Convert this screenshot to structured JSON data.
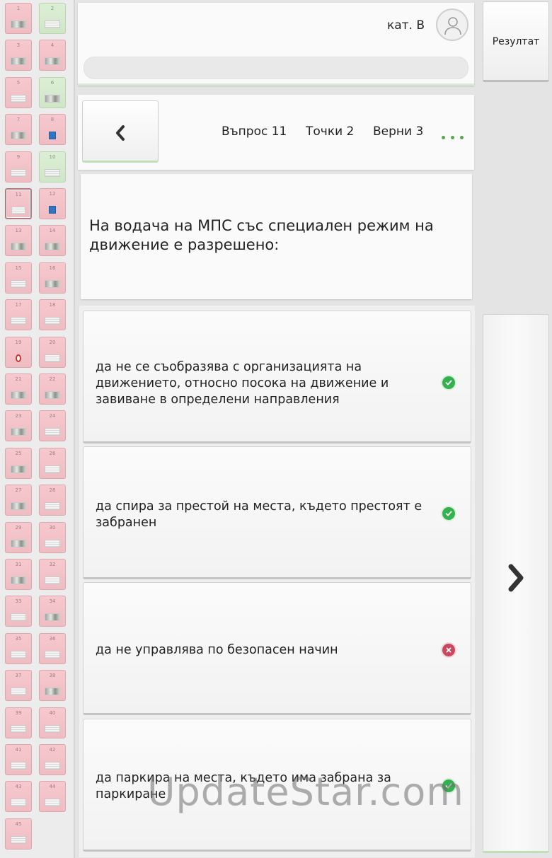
{
  "header": {
    "category": "кат. B",
    "result_label": "Резултат"
  },
  "nav": {
    "question": "Въпрос 11",
    "points": "Точки 2",
    "correct": "Верни 3"
  },
  "question": {
    "text": "На водача на МПС със специален режим на движение е разрешено:"
  },
  "answers": [
    {
      "text": "да не се съобразява с организацията на движението, относно посока на движение и завиване в определени направления",
      "mark": "correct"
    },
    {
      "text": "да спира за престой на места, където престоят е забранен",
      "mark": "correct"
    },
    {
      "text": "да не управлява по безопасен начин",
      "mark": "wrong"
    },
    {
      "text": "да паркира на места, където има забрана за паркиране",
      "mark": "correct"
    }
  ],
  "sidebar": {
    "questions": [
      {
        "n": "1",
        "state": "wrong",
        "pic": "photo"
      },
      {
        "n": "2",
        "state": "good",
        "pic": "lines"
      },
      {
        "n": "3",
        "state": "wrong",
        "pic": "photo"
      },
      {
        "n": "4",
        "state": "wrong",
        "pic": "photo"
      },
      {
        "n": "5",
        "state": "wrong",
        "pic": "lines"
      },
      {
        "n": "6",
        "state": "good",
        "pic": "photo"
      },
      {
        "n": "7",
        "state": "wrong",
        "pic": "photo"
      },
      {
        "n": "8",
        "state": "wrong",
        "pic": "sign-blue"
      },
      {
        "n": "9",
        "state": "wrong",
        "pic": "lines"
      },
      {
        "n": "10",
        "state": "good",
        "pic": "lines"
      },
      {
        "n": "11",
        "state": "current",
        "pic": "lines"
      },
      {
        "n": "12",
        "state": "wrong",
        "pic": "sign-blue"
      },
      {
        "n": "13",
        "state": "wrong",
        "pic": "photo"
      },
      {
        "n": "14",
        "state": "wrong",
        "pic": "photo"
      },
      {
        "n": "15",
        "state": "wrong",
        "pic": "lines"
      },
      {
        "n": "16",
        "state": "wrong",
        "pic": "photo"
      },
      {
        "n": "17",
        "state": "wrong",
        "pic": "lines"
      },
      {
        "n": "18",
        "state": "wrong",
        "pic": "lines"
      },
      {
        "n": "19",
        "state": "wrong",
        "pic": "sign-round"
      },
      {
        "n": "20",
        "state": "wrong",
        "pic": "lines"
      },
      {
        "n": "21",
        "state": "wrong",
        "pic": "photo"
      },
      {
        "n": "22",
        "state": "wrong",
        "pic": "photo"
      },
      {
        "n": "23",
        "state": "wrong",
        "pic": "photo"
      },
      {
        "n": "24",
        "state": "wrong",
        "pic": "lines"
      },
      {
        "n": "25",
        "state": "wrong",
        "pic": "photo"
      },
      {
        "n": "26",
        "state": "wrong",
        "pic": "lines"
      },
      {
        "n": "27",
        "state": "wrong",
        "pic": "photo"
      },
      {
        "n": "28",
        "state": "wrong",
        "pic": "lines"
      },
      {
        "n": "29",
        "state": "wrong",
        "pic": "photo"
      },
      {
        "n": "30",
        "state": "wrong",
        "pic": "lines"
      },
      {
        "n": "31",
        "state": "wrong",
        "pic": "photo"
      },
      {
        "n": "32",
        "state": "wrong",
        "pic": "lines"
      },
      {
        "n": "33",
        "state": "wrong",
        "pic": "lines"
      },
      {
        "n": "34",
        "state": "wrong",
        "pic": "photo"
      },
      {
        "n": "35",
        "state": "wrong",
        "pic": "lines"
      },
      {
        "n": "36",
        "state": "wrong",
        "pic": "lines"
      },
      {
        "n": "37",
        "state": "wrong",
        "pic": "lines"
      },
      {
        "n": "38",
        "state": "wrong",
        "pic": "photo"
      },
      {
        "n": "39",
        "state": "wrong",
        "pic": "lines"
      },
      {
        "n": "40",
        "state": "wrong",
        "pic": "lines"
      },
      {
        "n": "41",
        "state": "wrong",
        "pic": "lines"
      },
      {
        "n": "42",
        "state": "wrong",
        "pic": "lines"
      },
      {
        "n": "43",
        "state": "wrong",
        "pic": "lines"
      },
      {
        "n": "44",
        "state": "wrong",
        "pic": "lines"
      },
      {
        "n": "45",
        "state": "wrong",
        "pic": "lines"
      }
    ]
  },
  "watermark": "UpdateStar.com"
}
